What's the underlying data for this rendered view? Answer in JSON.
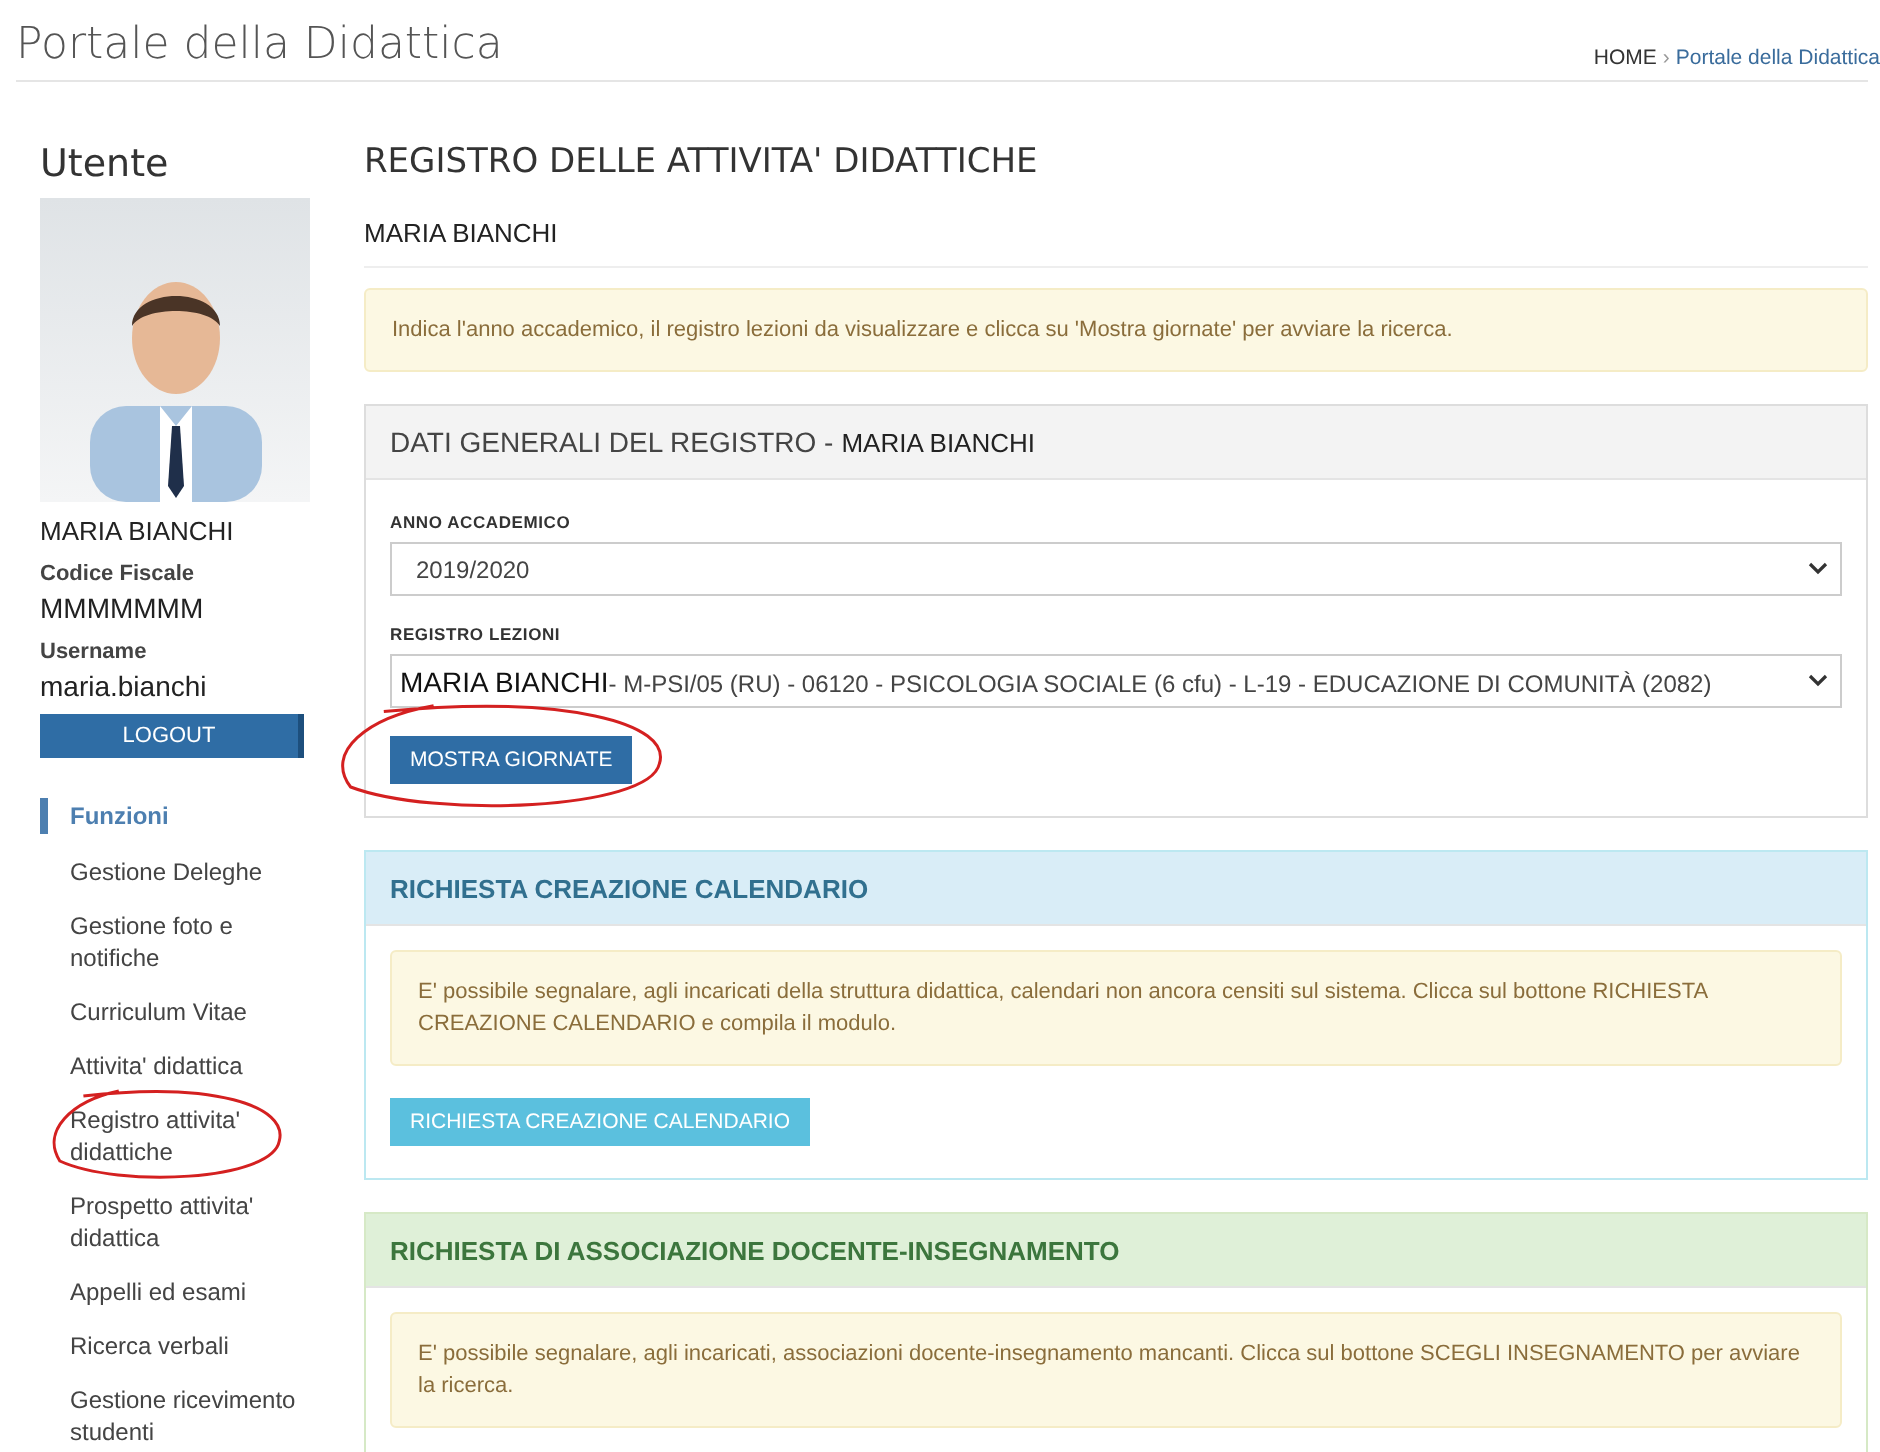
{
  "header": {
    "title": "Portale della Didattica",
    "breadcrumb": [
      "HOME",
      "Portale della Didattica"
    ],
    "separator": "›"
  },
  "sidebar": {
    "title": "Utente",
    "name": "MARIA BIANCHI",
    "fields": [
      {
        "label": "Codice Fiscale",
        "value": "MMMMMMM"
      },
      {
        "label": "Username",
        "value": "maria.bianchi"
      }
    ],
    "logout": "LOGOUT",
    "section": "Funzioni",
    "items": [
      {
        "label": "Gestione Deleghe",
        "circled": false
      },
      {
        "label": "Gestione foto e notifiche",
        "circled": false
      },
      {
        "label": "Curriculum Vitae",
        "circled": false
      },
      {
        "label": "Attivita' didattica",
        "circled": false
      },
      {
        "label": "Registro attivita' didattiche",
        "circled": true
      },
      {
        "label": "Prospetto attivita' didattica",
        "circled": false
      },
      {
        "label": "Appelli ed esami",
        "circled": false
      },
      {
        "label": "Ricerca verbali",
        "circled": false
      },
      {
        "label": "Gestione ricevimento studenti",
        "circled": false
      }
    ]
  },
  "main": {
    "title": "REGISTRO DELLE ATTIVITA' DIDATTICHE",
    "subtitle": "MARIA BIANCHI",
    "notice": "Indica l'anno accademico, il registro lezioni da visualizzare e clicca su 'Mostra giornate' per avviare la ricerca.",
    "general": {
      "title": "DATI GENERALI DEL REGISTRO - ",
      "title_name": "MARIA BIANCHI",
      "year_label": "ANNO ACCADEMICO",
      "year_value": "2019/2020",
      "register_label": "REGISTRO LEZIONI",
      "register_name": "MARIA BIANCHI",
      "register_rest": "- M-PSI/05 (RU) - 06120 - PSICOLOGIA SOCIALE (6 cfu) - L-19 - EDUCAZIONE DI COMUNITÀ (2082)",
      "button": "MOSTRA GIORNATE",
      "button_circled": true
    },
    "panels": [
      {
        "kind": "info",
        "title": "RICHIESTA CREAZIONE CALENDARIO",
        "text": "E' possibile segnalare, agli incaricati della struttura didattica, calendari non ancora censiti sul sistema. Clicca sul bottone RICHIESTA CREAZIONE CALENDARIO e compila il modulo.",
        "button": "RICHIESTA CREAZIONE CALENDARIO"
      },
      {
        "kind": "success",
        "title": "RICHIESTA DI ASSOCIAZIONE DOCENTE-INSEGNAMENTO",
        "text": "E' possibile segnalare, agli incaricati, associazioni docente-insegnamento mancanti. Clicca sul bottone SCEGLI INSEGNAMENTO per avviare la ricerca."
      }
    ]
  }
}
